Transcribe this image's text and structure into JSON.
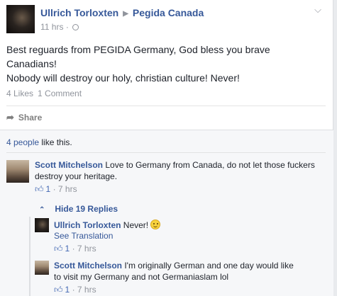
{
  "post": {
    "author": "Ullrich Torloxten",
    "target": "Pegida Canada",
    "time": "11 hrs",
    "dot": "·",
    "text_line1": "Best reguards from PEGIDA Germany, God bless you brave",
    "text_line2": "Canadians!",
    "text_line3": "Nobody will destroy our holy, christian culture! Never!",
    "likes": "4 Likes",
    "comments": "1 Comment",
    "share_label": "Share"
  },
  "likes_summary": {
    "people": "4 people",
    "suffix": " like this."
  },
  "comments": [
    {
      "author": "Scott Mitchelson",
      "text_line1": " Love to Germany from Canada, do not let those fuckers",
      "text_line2": "destroy your heritage.",
      "like_count": "1",
      "time": " · 7 hrs"
    }
  ],
  "replies_toggle": "Hide 19 Replies",
  "replies": [
    {
      "author": "Ullrich Torloxten",
      "text": " Never!",
      "see_translation": "See Translation",
      "like_count": "1",
      "time": " · 7 hrs"
    },
    {
      "author": "Scott Mitchelson",
      "text_line1": " I'm originally German and one day would like",
      "text_line2": "to visit my Germany and not Germaniaslam lol",
      "like_count": "1",
      "time": " · 7 hrs"
    }
  ],
  "icons": {
    "options": "chevron-down-icon",
    "audience": "globe-icon",
    "share": "share-arrow-icon",
    "like": "thumbs-up-icon",
    "emoji": "smile-emoji-icon"
  },
  "colors": {
    "link": "#365899",
    "meta": "#90949c",
    "like_blue": "#4267b2",
    "ufi_bg": "#f6f7f9"
  }
}
